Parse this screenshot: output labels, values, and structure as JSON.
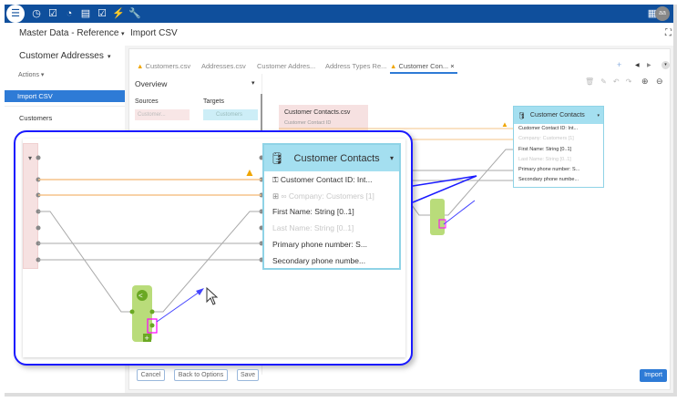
{
  "topbar": {
    "icons": [
      "database-icon",
      "clock-icon",
      "checkbox-icon",
      "gauge-icon",
      "list-icon",
      "checklist-icon",
      "plug-icon",
      "wrench-icon"
    ],
    "right_icons": [
      "report-icon"
    ],
    "avatar": "aa"
  },
  "breadcrumb": {
    "app": "Master Data - Reference",
    "page": "Import CSV"
  },
  "sidebar": {
    "title": "Customer Addresses",
    "actions": "Actions",
    "active": "Import CSV",
    "items": [
      "Customers"
    ]
  },
  "tabs": [
    {
      "label": "Customers.csv",
      "warning": true
    },
    {
      "label": "Addresses.csv"
    },
    {
      "label": "Customer Addres..."
    },
    {
      "label": "Address Types Re..."
    },
    {
      "label": "Customer Con...",
      "warning": true,
      "active": true
    }
  ],
  "overview": {
    "title": "Overview",
    "sources_label": "Sources",
    "targets_label": "Targets",
    "source": "Customer...",
    "target": "Customers"
  },
  "source_node": {
    "title": "Customer Contacts.csv",
    "first_row": "Customer Contact ID"
  },
  "target_node": {
    "title": "Customer Contacts",
    "fields": [
      {
        "label": "Customer Contact ID: Int...",
        "icon": "key-icon"
      },
      {
        "label": "Company: Customers [1]",
        "icon": "link-icon",
        "disabled": true
      },
      {
        "label": "First Name: String [0..1]"
      },
      {
        "label": "Last Name: String [0..1]",
        "disabled": true
      },
      {
        "label": "Primary phone number: S..."
      },
      {
        "label": "Secondary phone numbe..."
      }
    ]
  },
  "buttons": {
    "cancel": "Cancel",
    "back": "Back to Options",
    "save": "Save",
    "import": "Import"
  },
  "colors": {
    "topbar": "#0f4f9c",
    "accent": "#2e7bd6",
    "target_header": "#a4dff0",
    "source_bg": "#f6e1e1",
    "mapping_node": "#b9dc7a",
    "warning_line": "#f5c48a",
    "callout": "#1a1aff"
  }
}
